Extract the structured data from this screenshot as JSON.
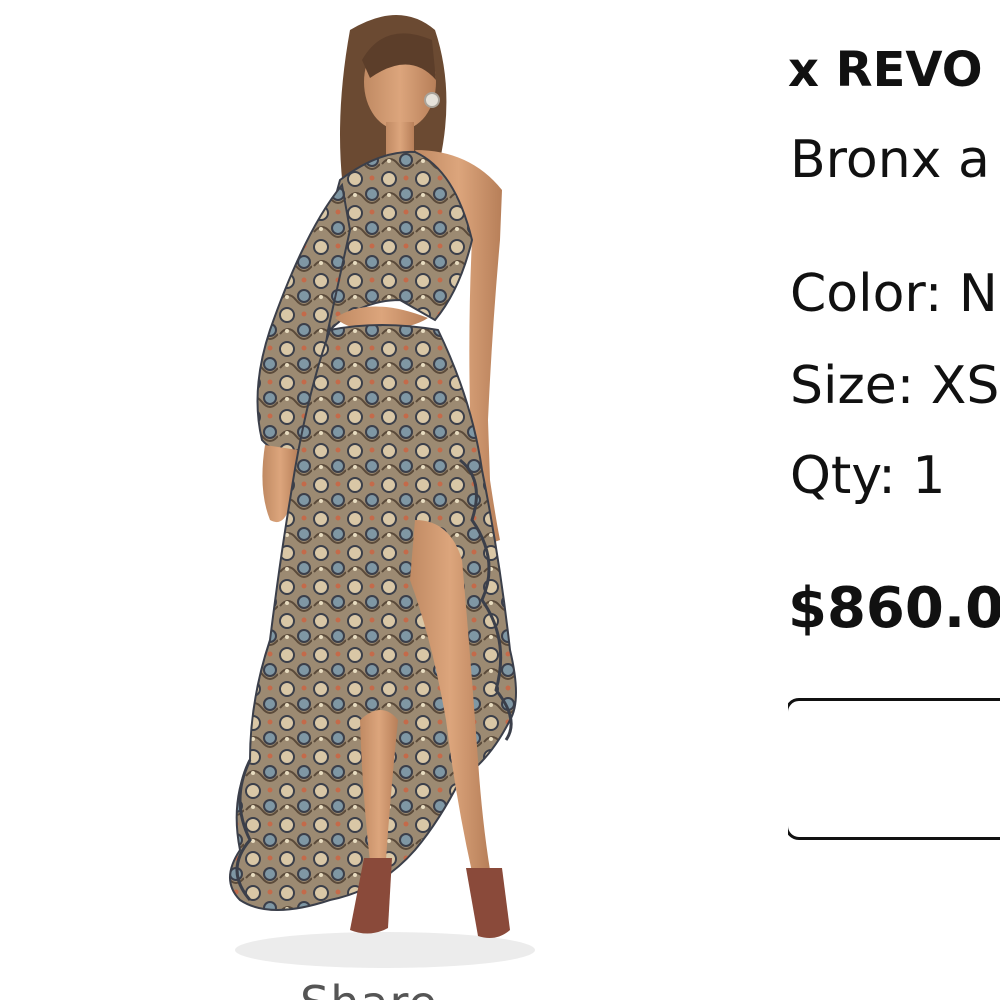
{
  "product": {
    "brand": "x REVO",
    "name": "Bronx a",
    "color_label": "Color:",
    "color_value": "N",
    "size_label": "Size:",
    "size_value": "XS",
    "qty_label": "Qty:",
    "qty_value": "1",
    "price": "$860.0",
    "image_caption": "Share",
    "dress_colors": [
      "#8a7a6a",
      "#c8b49a",
      "#3b3f4a",
      "#b6a07c",
      "#6e8a9a"
    ]
  }
}
